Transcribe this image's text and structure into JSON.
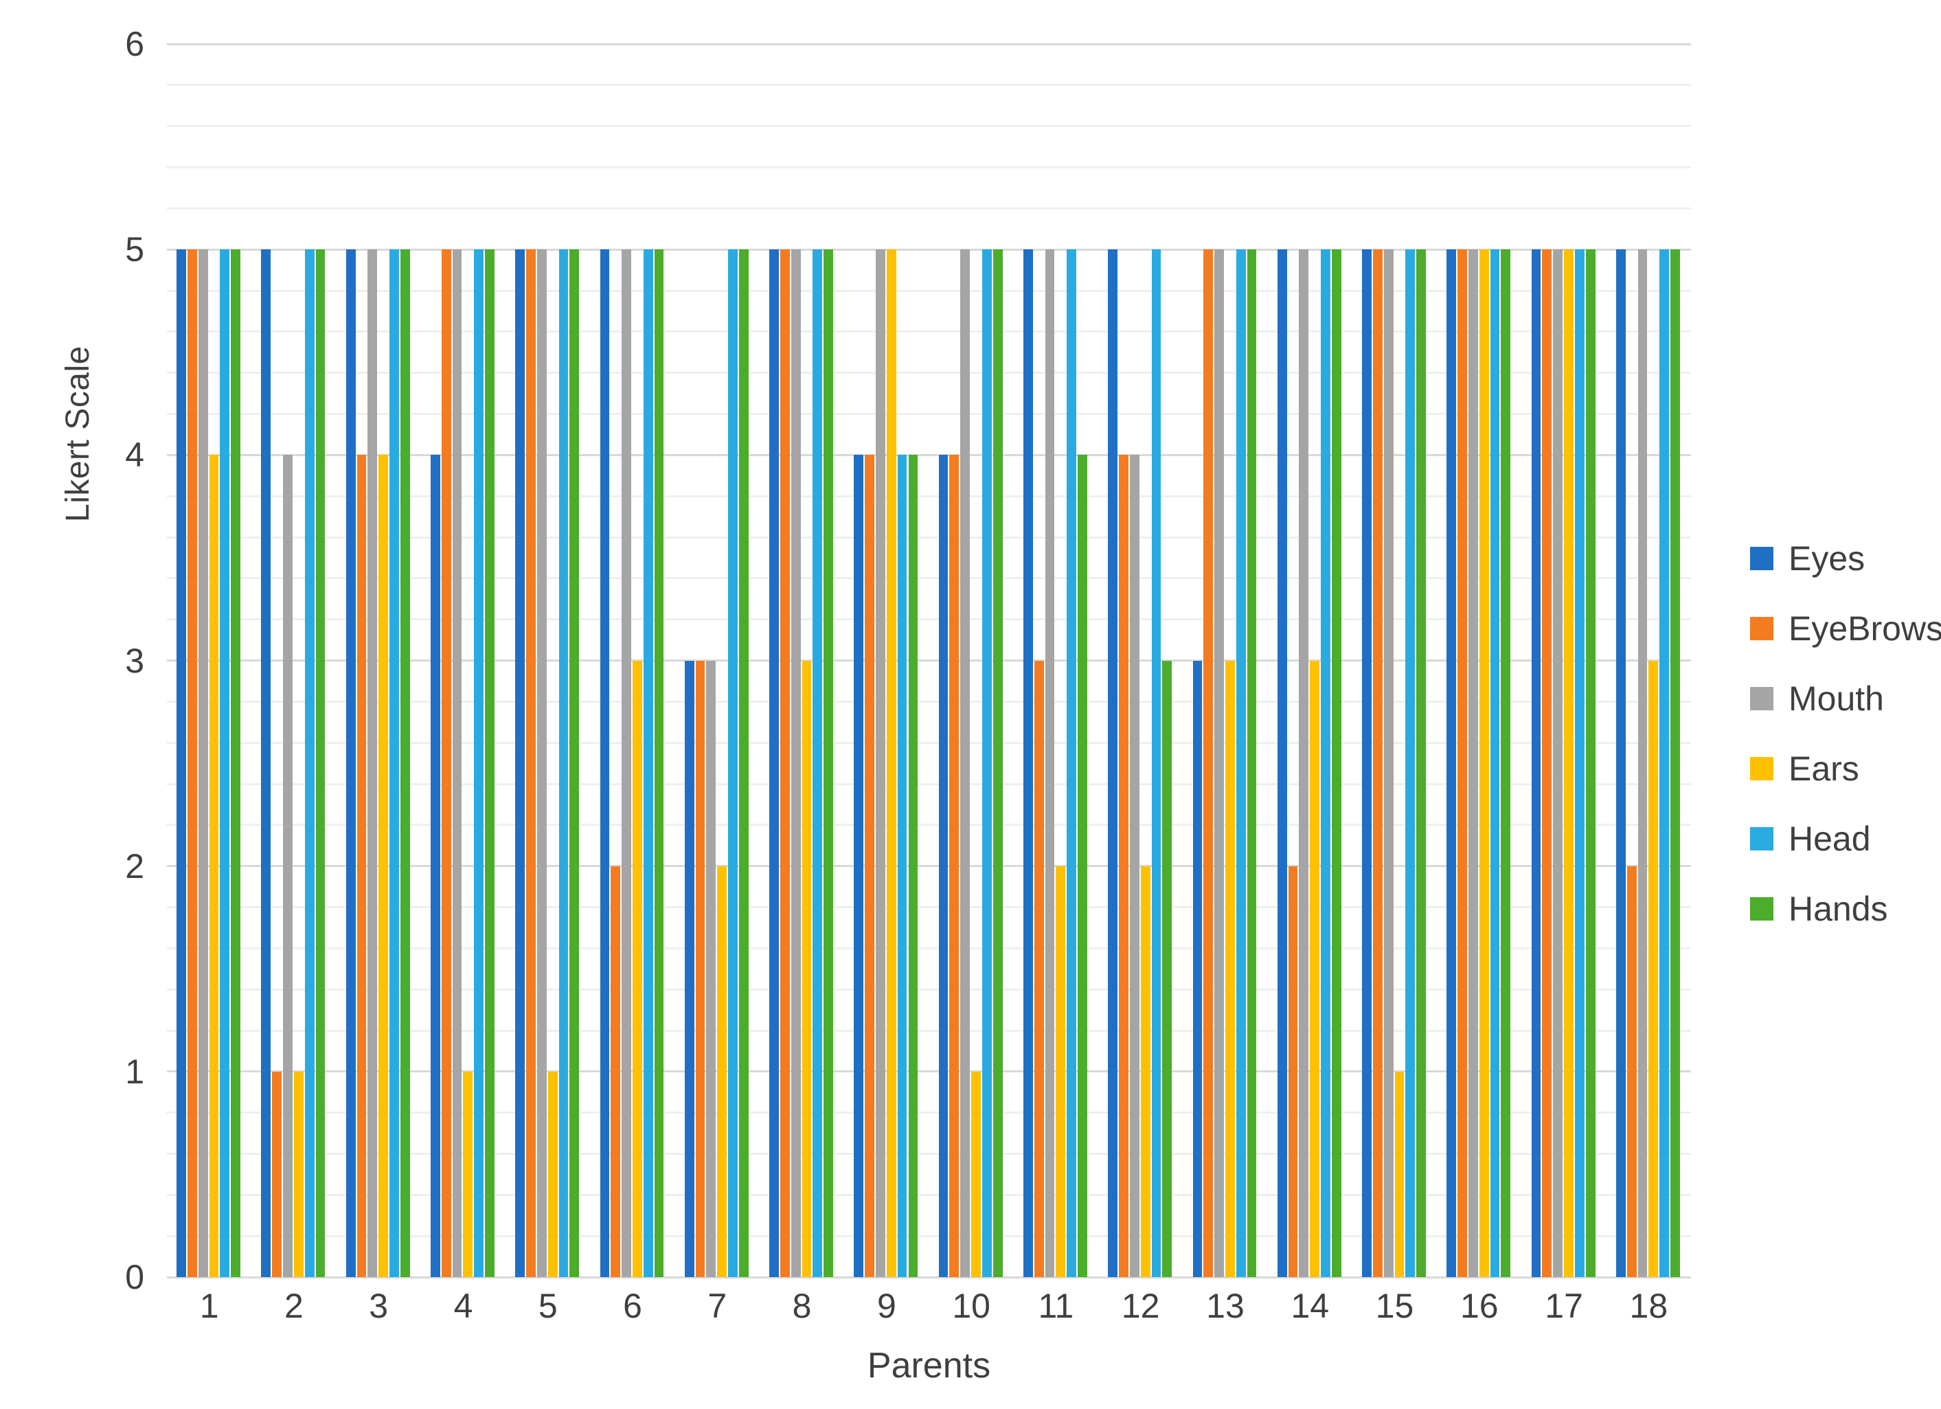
{
  "chart_data": {
    "type": "bar",
    "title": "",
    "xlabel": "Parents",
    "ylabel": "Likert Scale",
    "ylim": [
      0,
      6
    ],
    "yticks": [
      0,
      1,
      2,
      3,
      4,
      5,
      6
    ],
    "minor_gridlines": true,
    "grid": true,
    "legend_position": "right",
    "categories": [
      "1",
      "2",
      "3",
      "4",
      "5",
      "6",
      "7",
      "8",
      "9",
      "10",
      "11",
      "12",
      "13",
      "14",
      "15",
      "16",
      "17",
      "18"
    ],
    "series": [
      {
        "name": "Eyes",
        "color": "#1f6fc4",
        "values": [
          5,
          5,
          5,
          4,
          5,
          5,
          3,
          5,
          4,
          4,
          5,
          5,
          3,
          5,
          5,
          5,
          5,
          5
        ]
      },
      {
        "name": "EyeBrows",
        "color": "#f47b20",
        "values": [
          5,
          1,
          4,
          5,
          5,
          2,
          3,
          5,
          4,
          4,
          3,
          4,
          5,
          2,
          5,
          5,
          5,
          2
        ]
      },
      {
        "name": "Mouth",
        "color": "#a5a5a5",
        "values": [
          5,
          4,
          5,
          5,
          5,
          5,
          3,
          5,
          5,
          5,
          5,
          4,
          5,
          5,
          5,
          5,
          5,
          5
        ]
      },
      {
        "name": "Ears",
        "color": "#ffc000",
        "values": [
          4,
          1,
          4,
          1,
          1,
          3,
          2,
          3,
          5,
          1,
          2,
          2,
          3,
          3,
          1,
          5,
          5,
          3
        ]
      },
      {
        "name": "Head",
        "color": "#29abe2",
        "values": [
          5,
          5,
          5,
          5,
          5,
          5,
          5,
          5,
          4,
          5,
          5,
          5,
          5,
          5,
          5,
          5,
          5,
          5
        ]
      },
      {
        "name": "Hands",
        "color": "#4cac2b",
        "values": [
          5,
          5,
          5,
          5,
          5,
          5,
          5,
          5,
          4,
          5,
          4,
          3,
          5,
          5,
          5,
          5,
          5,
          5
        ]
      }
    ]
  },
  "axis": {
    "y_title": "Likert Scale",
    "x_title": "Parents",
    "y_tick_labels": [
      "0",
      "1",
      "2",
      "3",
      "4",
      "5",
      "6"
    ],
    "x_tick_labels": [
      "1",
      "2",
      "3",
      "4",
      "5",
      "6",
      "7",
      "8",
      "9",
      "10",
      "11",
      "12",
      "13",
      "14",
      "15",
      "16",
      "17",
      "18"
    ]
  },
  "legend": {
    "items": [
      {
        "label": "Eyes",
        "color": "#1f6fc4"
      },
      {
        "label": "EyeBrows",
        "color": "#f47b20"
      },
      {
        "label": "Mouth",
        "color": "#a5a5a5"
      },
      {
        "label": "Ears",
        "color": "#ffc000"
      },
      {
        "label": "Head",
        "color": "#29abe2"
      },
      {
        "label": "Hands",
        "color": "#4cac2b"
      }
    ]
  }
}
